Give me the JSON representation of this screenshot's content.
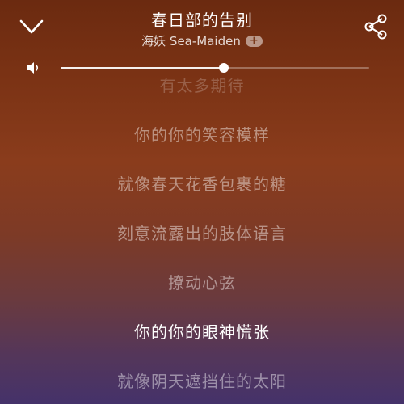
{
  "header": {
    "title": "春日部的告别",
    "artist": "海妖 Sea-Maiden",
    "add_badge": "+"
  },
  "volume": {
    "level": 0.53
  },
  "lyrics": [
    {
      "text": "有太多期待",
      "state": "faded"
    },
    {
      "text": "你的你的笑容模样",
      "state": "normal"
    },
    {
      "text": "就像春天花香包裹的糖",
      "state": "normal"
    },
    {
      "text": "刻意流露出的肢体语言",
      "state": "normal"
    },
    {
      "text": "撩动心弦",
      "state": "normal"
    },
    {
      "text": "你的你的眼神慌张",
      "state": "current"
    },
    {
      "text": "就像阴天遮挡住的太阳",
      "state": "normal"
    }
  ],
  "icons": {
    "collapse": "chevron-down-icon",
    "share": "share-icon",
    "volume": "speaker-icon"
  }
}
